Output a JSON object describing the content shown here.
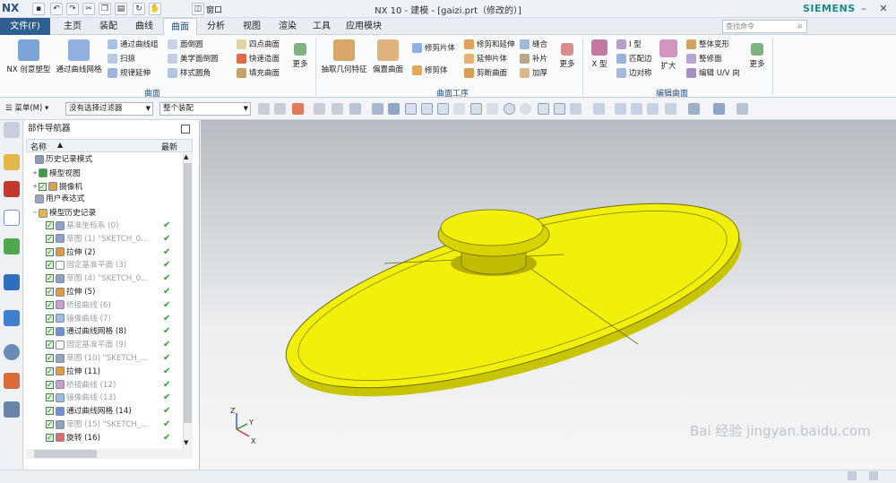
{
  "app": {
    "logo": "NX",
    "window_title": "NX 10 - 建模 - [gaizi.prt（修改的）]",
    "brand": "SIEMENS",
    "window_menu": "窗口",
    "search_placeholder": "查找命令"
  },
  "tabs": [
    "文件(F)",
    "主页",
    "装配",
    "曲线",
    "曲面",
    "分析",
    "视图",
    "渲染",
    "工具",
    "应用模块"
  ],
  "active_tab": "曲面",
  "ribbon": {
    "group_surface": {
      "label": "曲面",
      "big": [
        "NX 创意塑型",
        "通过曲线网格"
      ],
      "col1": [
        "通过曲线组",
        "扫掠",
        "规律延伸"
      ],
      "col2": [
        "面倒圆",
        "美学面倒圆",
        "样式圆角"
      ],
      "col3": [
        "四点曲面",
        "快速造面",
        "填充曲面"
      ],
      "more": "更多"
    },
    "group_ops": {
      "label": "曲面工序",
      "big": [
        "抽取几何特征",
        "偏置曲面"
      ],
      "col1": [
        "修剪片体",
        "修剪体"
      ],
      "col2": [
        "修剪和延伸",
        "延伸片体",
        "剪断曲面"
      ],
      "col3": [
        "缝合",
        "补片",
        "加厚"
      ],
      "more": "更多"
    },
    "group_edit": {
      "label": "编辑曲面",
      "big": [
        "X 型",
        "扩大"
      ],
      "col1": [
        "I 型",
        "匹配边",
        "边对称"
      ],
      "col2": [
        "整体变形",
        "整修面",
        "编辑 U/V 向"
      ],
      "more": "更多"
    }
  },
  "toolbar": {
    "menu_label": "菜单(M)",
    "filter_value": "没有选择过滤器",
    "assembly_value": "整个装配"
  },
  "navigator": {
    "title": "部件导航器",
    "col_name": "名称",
    "col_new": "最新",
    "rows": [
      {
        "label": "历史记录模式",
        "dim": false,
        "check": false
      },
      {
        "label": "模型视图",
        "dim": false,
        "check": false
      },
      {
        "label": "摄像机",
        "dim": false,
        "check": true
      },
      {
        "label": "用户表达式",
        "dim": false,
        "check": false
      },
      {
        "label": "模型历史记录",
        "dim": false,
        "check": false
      },
      {
        "label": "基准坐标系 (0)",
        "dim": true,
        "check": true
      },
      {
        "label": "草图 (1) \"SKETCH_0...",
        "dim": true,
        "check": true
      },
      {
        "label": "拉伸 (2)",
        "dim": false,
        "check": true
      },
      {
        "label": "固定基准平面 (3)",
        "dim": true,
        "check": true
      },
      {
        "label": "草图 (4) \"SKETCH_0...",
        "dim": true,
        "check": true
      },
      {
        "label": "拉伸 (5)",
        "dim": false,
        "check": true
      },
      {
        "label": "桥接曲线 (6)",
        "dim": true,
        "check": true
      },
      {
        "label": "镜像曲线 (7)",
        "dim": true,
        "check": true
      },
      {
        "label": "通过曲线网格 (8)",
        "dim": false,
        "check": true
      },
      {
        "label": "固定基准平面 (9)",
        "dim": true,
        "check": true
      },
      {
        "label": "草图 (10) \"SKETCH_...",
        "dim": true,
        "check": true
      },
      {
        "label": "拉伸 (11)",
        "dim": false,
        "check": true
      },
      {
        "label": "桥接曲线 (12)",
        "dim": true,
        "check": true
      },
      {
        "label": "镜像曲线 (13)",
        "dim": true,
        "check": true
      },
      {
        "label": "通过曲线网格 (14)",
        "dim": false,
        "check": true
      },
      {
        "label": "草图 (15) \"SKETCH_...",
        "dim": true,
        "check": true
      },
      {
        "label": "旋转 (16)",
        "dim": false,
        "check": true
      }
    ]
  },
  "triad": {
    "x": "X",
    "y": "Y",
    "z": "Z"
  },
  "watermark": "Bai 经验 jingyan.baidu.com",
  "colors": {
    "accent": "#2f5f8f",
    "model_yellow": "#f2f00a",
    "check_green": "#2aa02a"
  }
}
